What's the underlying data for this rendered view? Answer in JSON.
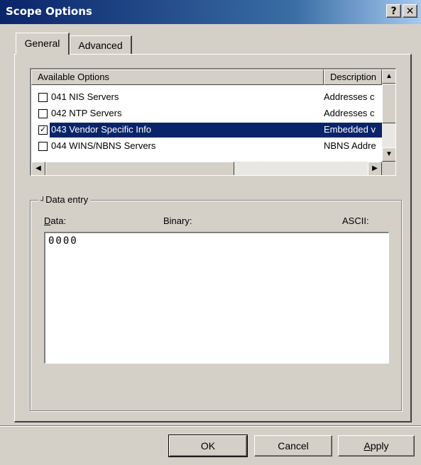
{
  "window": {
    "title": "Scope Options",
    "help_label": "?",
    "close_label": "✕"
  },
  "tabs": [
    {
      "label": "General",
      "active": true
    },
    {
      "label": "Advanced",
      "active": false
    }
  ],
  "options_list": {
    "columns": [
      "Available Options",
      "Description"
    ],
    "rows": [
      {
        "checked": false,
        "name": "041 NIS Servers",
        "description": "Addresses c"
      },
      {
        "checked": false,
        "name": "042 NTP Servers",
        "description": "Addresses c"
      },
      {
        "checked": true,
        "name": "043 Vendor Specific Info",
        "description": "Embedded v",
        "selected": true
      },
      {
        "checked": false,
        "name": "044 WINS/NBNS Servers",
        "description": "NBNS Addre"
      }
    ]
  },
  "data_entry": {
    "group_label": "Data entry",
    "data_label": "Data:",
    "binary_label": "Binary:",
    "ascii_label": "ASCII:",
    "value": "0000"
  },
  "buttons": {
    "ok": "OK",
    "cancel": "Cancel",
    "apply": "Apply"
  },
  "colors": {
    "selection": "#0a246a",
    "title_start": "#0a246a",
    "face": "#d4d0c8"
  }
}
